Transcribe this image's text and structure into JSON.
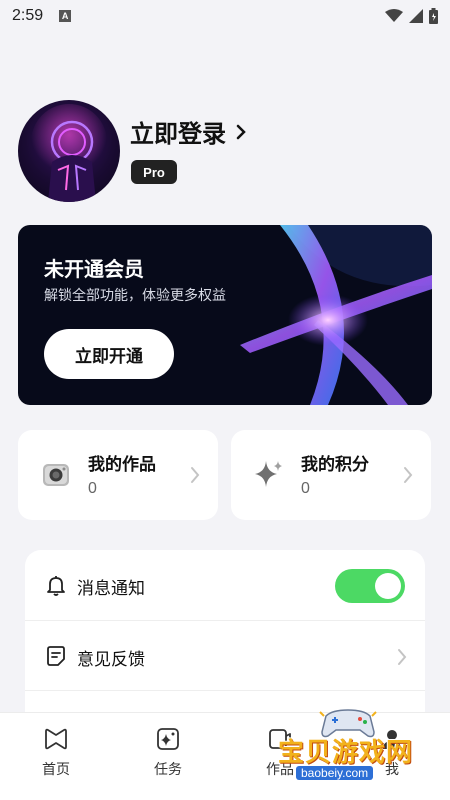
{
  "status_bar": {
    "time": "2:59",
    "indicator": "A",
    "icons": [
      "wifi-icon",
      "signal-icon",
      "battery-icon"
    ]
  },
  "profile": {
    "login_label": "立即登录",
    "badge": "Pro"
  },
  "membership": {
    "title": "未开通会员",
    "subtitle": "解锁全部功能，体验更多权益",
    "button": "立即开通"
  },
  "stats": [
    {
      "label": "我的作品",
      "value": "0",
      "icon": "camera-icon"
    },
    {
      "label": "我的积分",
      "value": "0",
      "icon": "sparkle-icon"
    }
  ],
  "settings": [
    {
      "label": "消息通知",
      "icon": "bell-icon",
      "toggle_on": true
    },
    {
      "label": "意见反馈",
      "icon": "feedback-icon"
    }
  ],
  "nav": [
    {
      "label": "首页",
      "icon": "home-icon"
    },
    {
      "label": "任务",
      "icon": "task-icon"
    },
    {
      "label": "作品",
      "icon": "works-icon"
    },
    {
      "label": "我",
      "icon": "profile-icon"
    }
  ],
  "colors": {
    "toggle_on": "#4cd964",
    "vip_bg": "#070a1a",
    "page_bg": "#f3f3f7"
  },
  "watermark": {
    "text": "宝贝游戏网",
    "url": "baobeiy.com"
  }
}
